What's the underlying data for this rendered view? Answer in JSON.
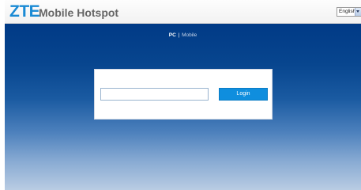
{
  "header": {
    "logo_text": "ZTE",
    "title": "Mobile Hotspot",
    "language": {
      "selected": "English"
    }
  },
  "view_switch": {
    "pc_label": "PC",
    "separator": "|",
    "mobile_label": "Mobile"
  },
  "login": {
    "password_value": "",
    "button_label": "Login"
  },
  "colors": {
    "brand_blue": "#1a8ad4",
    "button_blue": "#0f8ede",
    "background_top": "#003a86",
    "background_bottom": "#b9cce3"
  }
}
